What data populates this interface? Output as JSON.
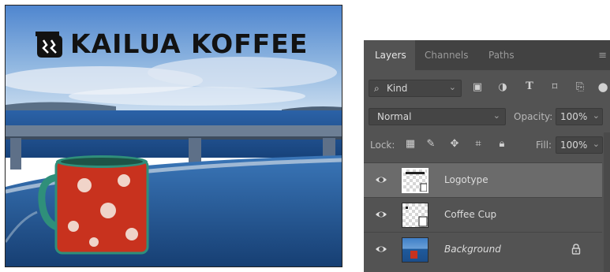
{
  "photo": {
    "logo_text": "KAILUA KOFFEE",
    "colors": {
      "sky": "#5b8fd0",
      "sea": "#1f5aa0",
      "mug_red": "#c8321e",
      "mug_teal": "#2f8f7a"
    }
  },
  "layers_panel": {
    "tabs": [
      {
        "label": "Layers",
        "active": true
      },
      {
        "label": "Channels",
        "active": false
      },
      {
        "label": "Paths",
        "active": false
      }
    ],
    "filter": {
      "value": "Kind",
      "icons": [
        "image-filter-icon",
        "adjustment-filter-icon",
        "type-filter-icon",
        "shape-filter-icon",
        "smart-object-filter-icon"
      ]
    },
    "blend_mode": "Normal",
    "opacity_label": "Opacity:",
    "opacity_value": "100%",
    "lock_label": "Lock:",
    "lock_icons": [
      "lock-transparent-pixels-icon",
      "lock-image-pixels-icon",
      "lock-position-icon",
      "lock-artboard-icon",
      "lock-all-icon"
    ],
    "fill_label": "Fill:",
    "fill_value": "100%",
    "layers": [
      {
        "name": "Logotype",
        "selected": true,
        "visible": true,
        "locked": false
      },
      {
        "name": "Coffee Cup",
        "selected": false,
        "visible": true,
        "locked": false
      },
      {
        "name": "Background",
        "selected": false,
        "visible": true,
        "locked": true
      }
    ],
    "colors": {
      "panel": "#535353",
      "selected_row": "#6b6b6b"
    }
  }
}
